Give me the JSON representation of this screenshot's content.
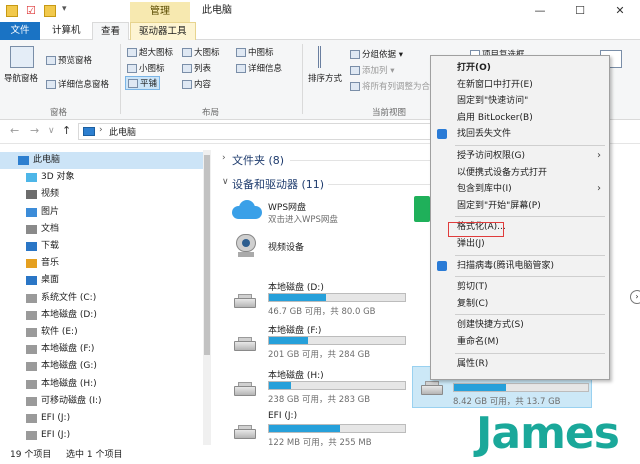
{
  "window": {
    "title": "此电脑",
    "context_tab": "管理",
    "controls": {
      "minimize": "—",
      "maximize": "☐",
      "close": "✕"
    }
  },
  "ribbon_tabs": [
    "文件",
    "计算机",
    "查看",
    "驱动器工具"
  ],
  "ribbon": {
    "pane_group": {
      "nav_pane": "导航窗格",
      "preview": "预览窗格",
      "details": "详细信息窗格",
      "label": "窗格"
    },
    "layout_group": {
      "items": [
        "超大图标",
        "大图标",
        "中图标",
        "小图标",
        "列表",
        "详细信息",
        "平铺",
        "内容"
      ],
      "label": "布局"
    },
    "view_group": {
      "sort": "排序方式",
      "group_by": "分组依据",
      "add_column": "添加列",
      "fit_columns": "将所有列调整为合适的大小",
      "label": "当前视图"
    },
    "show_group": {
      "item_checkbox": "项目复选框"
    }
  },
  "address": {
    "path": "此电脑"
  },
  "nav": {
    "items": [
      {
        "label": "此电脑",
        "icon": "computer-icon",
        "selected": true
      },
      {
        "label": "3D 对象",
        "icon": "3d-objects-icon"
      },
      {
        "label": "视频",
        "icon": "video-icon"
      },
      {
        "label": "图片",
        "icon": "picture-icon"
      },
      {
        "label": "文档",
        "icon": "document-icon"
      },
      {
        "label": "下载",
        "icon": "download-icon"
      },
      {
        "label": "音乐",
        "icon": "music-icon"
      },
      {
        "label": "桌面",
        "icon": "desktop-icon"
      },
      {
        "label": "系统文件 (C:)",
        "icon": "drive-icon"
      },
      {
        "label": "本地磁盘 (D:)",
        "icon": "drive-icon"
      },
      {
        "label": "软件 (E:)",
        "icon": "drive-icon"
      },
      {
        "label": "本地磁盘 (F:)",
        "icon": "drive-icon"
      },
      {
        "label": "本地磁盘 (G:)",
        "icon": "drive-icon"
      },
      {
        "label": "本地磁盘 (H:)",
        "icon": "drive-icon"
      },
      {
        "label": "可移动磁盘 (I:)",
        "icon": "drive-icon"
      },
      {
        "label": "EFI (J:)",
        "icon": "drive-icon"
      },
      {
        "label": "EFI (J:)",
        "icon": "drive-icon"
      }
    ]
  },
  "content": {
    "folders_header": "文件夹 (8)",
    "devices_header": "设备和驱动器 (11)",
    "wps": {
      "name": "WPS网盘",
      "sub": "双击进入WPS网盘"
    },
    "video_device": {
      "name": "视频设备"
    },
    "drives": [
      {
        "name": "本地磁盘 (D:)",
        "sub": "46.7 GB 可用，共 80.0 GB",
        "used_fraction": 0.42
      },
      {
        "name": "本地磁盘 (F:)",
        "sub": "201 GB 可用，共 284 GB",
        "used_fraction": 0.29
      },
      {
        "name": "本地磁盘 (H:)",
        "sub": "238 GB 可用，共 283 GB",
        "used_fraction": 0.16
      },
      {
        "name": "EFI (J:)",
        "sub": "122 MB 可用，共 255 MB",
        "used_fraction": 0.52
      }
    ],
    "selected_drive": {
      "sub": "8.42 GB 可用，共 13.7 GB",
      "used_fraction": 0.39
    }
  },
  "context_menu": {
    "items": [
      {
        "label": "打开(O)",
        "bold": true
      },
      {
        "label": "在新窗口中打开(E)"
      },
      {
        "label": "固定到\"快速访问\""
      },
      {
        "label": "启用 BitLocker(B)"
      },
      {
        "label": "找回丢失文件",
        "icon": "recover-icon"
      },
      {
        "sep": true
      },
      {
        "label": "授予访问权限(G)",
        "submenu": true
      },
      {
        "label": "以便携式设备方式打开"
      },
      {
        "label": "包含到库中(I)",
        "submenu": true
      },
      {
        "label": "固定到\"开始\"屏幕(P)"
      },
      {
        "sep": true
      },
      {
        "label": "格式化(A)...",
        "highlighted": true
      },
      {
        "label": "弹出(J)"
      },
      {
        "sep": true
      },
      {
        "label": "扫描病毒(腾讯电脑管家)",
        "icon": "shield-icon"
      },
      {
        "sep": true
      },
      {
        "label": "剪切(T)"
      },
      {
        "label": "复制(C)"
      },
      {
        "sep": true
      },
      {
        "label": "创建快捷方式(S)"
      },
      {
        "label": "重命名(M)"
      },
      {
        "sep": true
      },
      {
        "label": "属性(R)"
      }
    ]
  },
  "status": {
    "count": "19 个项目",
    "selected": "选中 1 个项目"
  },
  "watermark": "James",
  "colors": {
    "accent": "#1a73c4",
    "drive_bar": "#26a0da",
    "highlight_box": "#e03c3c",
    "watermark": "#1aa89a"
  }
}
